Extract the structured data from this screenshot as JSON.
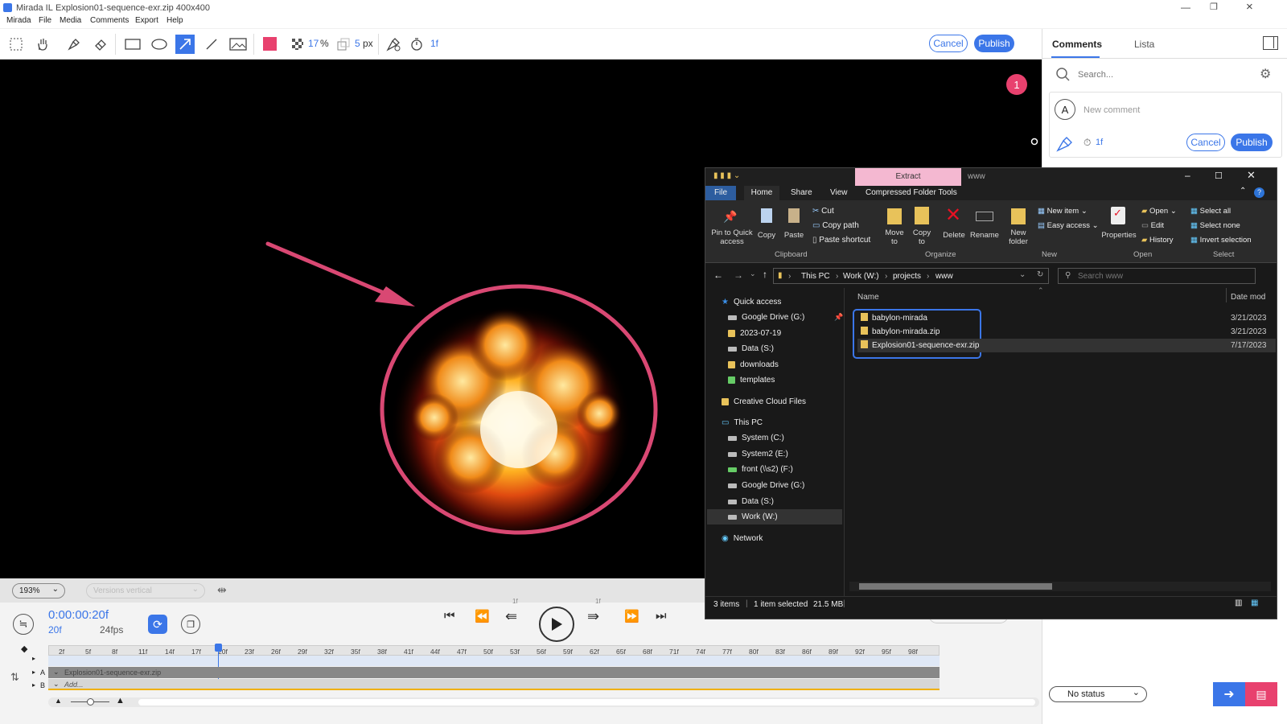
{
  "app": {
    "name": "Mirada IL",
    "doc_title": "Explosion01-sequence-exr.zip 400x400"
  },
  "menu": [
    "Mirada",
    "File",
    "Media",
    "Comments",
    "Export",
    "Help"
  ],
  "toolbar": {
    "fill_percent": "17",
    "percent_sign": "%",
    "brush_size": "5",
    "px": "px",
    "frame": "1f",
    "cancel": "Cancel",
    "publish": "Publish",
    "color": "#e8416e",
    "accent": "#3b76e8"
  },
  "viewer": {
    "badge": "1",
    "arrow_color": "#d94873"
  },
  "zoom": {
    "level": "193%",
    "versions": "Versions vertical"
  },
  "playback": {
    "timecode": "0:00:00:20f",
    "frame": "20f",
    "fps": "24fps",
    "step_back_lbl": "1f",
    "step_fwd_lbl": "1f"
  },
  "timeline": {
    "ticks": [
      "2f",
      "5f",
      "8f",
      "11f",
      "14f",
      "17f",
      "20f",
      "23f",
      "26f",
      "29f",
      "32f",
      "35f",
      "38f",
      "41f",
      "44f",
      "47f",
      "50f",
      "53f",
      "56f",
      "59f",
      "62f",
      "65f",
      "68f",
      "71f",
      "74f",
      "77f",
      "80f",
      "83f",
      "86f",
      "89f",
      "92f",
      "95f",
      "98f"
    ],
    "track_a": "Explosion01-sequence-exr.zip",
    "track_b": "Add...",
    "lbl_a": "A",
    "lbl_b": "B"
  },
  "comments": {
    "tab_comments": "Comments",
    "tab_list": "Lista",
    "search_placeholder": "Search...",
    "avatar": "A",
    "new_comment": "New comment",
    "frame": "1f",
    "cancel": "Cancel",
    "publish": "Publish",
    "status": "No status"
  },
  "explorer": {
    "title_tab": "Extract",
    "title_path": "www",
    "tabs": [
      "File",
      "Home",
      "Share",
      "View",
      "Compressed Folder Tools"
    ],
    "ribbon": {
      "pin": "Pin to Quick access",
      "copy": "Copy",
      "paste": "Paste",
      "cut": "Cut",
      "copy_path": "Copy path",
      "paste_shortcut": "Paste shortcut",
      "move_to": "Move to",
      "copy_to": "Copy to",
      "delete": "Delete",
      "rename": "Rename",
      "new_folder": "New folder",
      "new_item": "New item",
      "easy_access": "Easy access",
      "properties": "Properties",
      "open": "Open",
      "edit": "Edit",
      "history": "History",
      "select_all": "Select all",
      "select_none": "Select none",
      "invert": "Invert selection"
    },
    "groups": [
      "Clipboard",
      "Organize",
      "New",
      "Open",
      "Select"
    ],
    "breadcrumb": [
      "This PC",
      "Work (W:)",
      "projects",
      "www"
    ],
    "search_placeholder": "Search www",
    "nav": [
      "Quick access",
      "Google Drive (G:)",
      "2023-07-19",
      "Data (S:)",
      "downloads",
      "templates",
      "Creative Cloud Files",
      "This PC",
      "System (C:)",
      "System2 (E:)",
      "front (\\\\s2) (F:)",
      "Google Drive (G:)",
      "Data (S:)",
      "Work (W:)",
      "Network"
    ],
    "col_name": "Name",
    "col_date": "Date mod",
    "files": [
      {
        "name": "babylon-mirada",
        "date": "3/21/2023"
      },
      {
        "name": "babylon-mirada.zip",
        "date": "3/21/2023"
      },
      {
        "name": "Explosion01-sequence-exr.zip",
        "date": "7/17/2023"
      }
    ],
    "status": {
      "items": "3 items",
      "selected": "1 item selected",
      "size": "21.5 MB"
    }
  }
}
